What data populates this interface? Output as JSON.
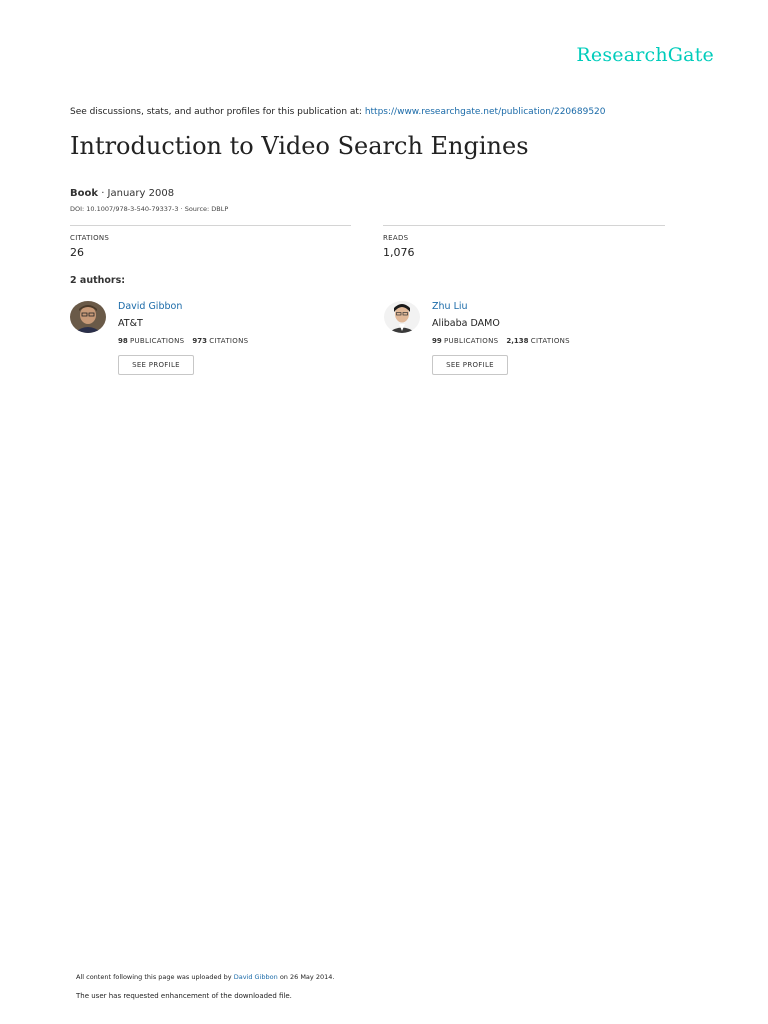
{
  "header": {
    "logo": "ResearchGate",
    "see_discussions_prefix": "See discussions, stats, and author profiles for this publication at: ",
    "publication_url": "https://www.researchgate.net/publication/220689520"
  },
  "publication": {
    "title": "Introduction to Video Search Engines",
    "type": "Book",
    "date_sep": " · January 2008",
    "doi_line": "DOI: 10.1007/978-3-540-79337-3 · Source: DBLP"
  },
  "stats": {
    "citations_label": "CITATIONS",
    "citations_value": "26",
    "reads_label": "READS",
    "reads_value": "1,076"
  },
  "authors_heading": "2 authors:",
  "authors": [
    {
      "name": "David Gibbon",
      "institution": "AT&T",
      "publications_count": "98",
      "publications_label": "PUBLICATIONS",
      "citations_count": "973",
      "citations_label": "CITATIONS",
      "button_label": "SEE PROFILE"
    },
    {
      "name": "Zhu Liu",
      "institution": "Alibaba DAMO",
      "publications_count": "99",
      "publications_label": "PUBLICATIONS",
      "citations_count": "2,138",
      "citations_label": "CITATIONS",
      "button_label": "SEE PROFILE"
    }
  ],
  "footer": {
    "uploaded_prefix": "All content following this page was uploaded by ",
    "uploader": "David Gibbon",
    "uploaded_suffix": " on 26 May 2014.",
    "enhancement_note": "The user has requested enhancement of the downloaded file."
  },
  "colors": {
    "brand": "#00ccbb",
    "link": "#1a6aa8"
  }
}
